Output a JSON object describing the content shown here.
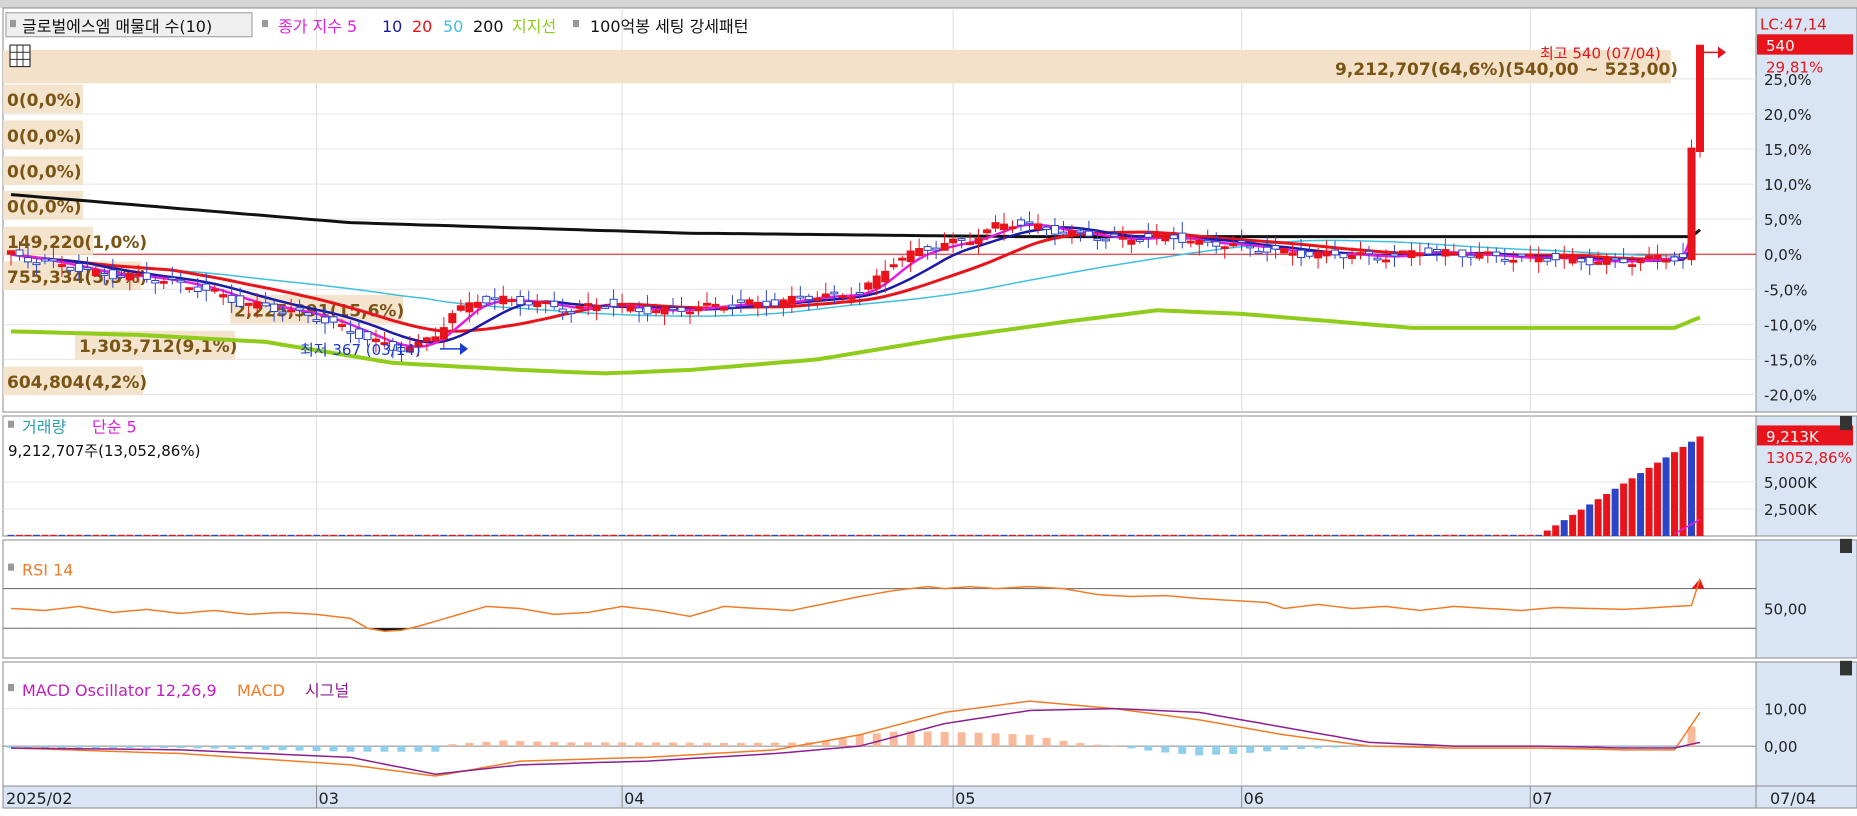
{
  "legend": {
    "main": {
      "stock_name": "글로벌에스엠 매물대 수(10)",
      "ma_label": "종가 지수 5",
      "ma_periods": [
        "10",
        "20",
        "50",
        "200"
      ],
      "support": "지지선",
      "pattern": "100억봉 세팅 강세패턴"
    },
    "volume": {
      "title": "거래량",
      "ma": "단순 5",
      "info": "9,212,707주(13,052,86%)"
    },
    "rsi": {
      "title": "RSI 14"
    },
    "macd": {
      "title": "MACD Oscillator 12,26,9",
      "macd": "MACD",
      "signal": "시그널"
    }
  },
  "annotations": {
    "high": "최고 540 (07/04)",
    "low": "최저 367 (03/14)",
    "volume_profile_top": "9,212,707(64,6%)(540,00 ~ 523,00)",
    "lc": "LC:47,14",
    "last_price": "540",
    "last_pct": "29,81%",
    "vol_last": "9,213K",
    "vol_last_pct": "13052,86%"
  },
  "volume_profile": [
    "0(0,0%)",
    "0(0,0%)",
    "0(0,0%)",
    "0(0,0%)",
    "149,220(1,0%)",
    "755,334(5,3%)",
    "2,225,391(15,6%)",
    "1,303,712(9,1%)",
    "604,804(4,2%)"
  ],
  "colors": {
    "up": "#e8131b",
    "down": "#2b44c8",
    "ma5": "#e020e0",
    "ma10": "#1a1aa8",
    "ma20": "#e8131b",
    "ma50": "#40c0e0",
    "ma200": "#111111",
    "support": "#8fcc1c",
    "rsi": "#f07c28",
    "macd": "#f07c28",
    "signal": "#8b2090",
    "osc_pos": "#f7b99a",
    "osc_neg": "#90d0ec",
    "axis_bg": "#d9e5f5",
    "profile": "#f3e1c9",
    "profile_text": "#7a5414"
  },
  "chart_data": [
    {
      "type": "line",
      "title": "글로벌에스엠",
      "y_axis_ticks": [
        "25,0%",
        "20,0%",
        "15,0%",
        "10,0%",
        "5,0%",
        "0,0%",
        "-5,0%",
        "-10,0%",
        "-15,0%",
        "-20,0%"
      ],
      "ylim_pct": [
        -22.5,
        30
      ],
      "base_pct": 0,
      "series": [
        {
          "name": "종가",
          "points": [
            [
              0,
              0
            ],
            [
              3,
              -1
            ],
            [
              6,
              -1.5
            ],
            [
              9,
              -2.5
            ],
            [
              12,
              -3
            ],
            [
              15,
              -3.2
            ],
            [
              18,
              -3.8
            ],
            [
              21,
              -4.5
            ],
            [
              24,
              -5.5
            ],
            [
              27,
              -7
            ],
            [
              30,
              -7.5
            ],
            [
              33,
              -8.2
            ],
            [
              36,
              -9
            ],
            [
              39,
              -10.5
            ],
            [
              42,
              -12
            ],
            [
              45,
              -13.5
            ],
            [
              48,
              -13
            ],
            [
              50,
              -11.5
            ],
            [
              52,
              -8.5
            ],
            [
              55,
              -6.5
            ],
            [
              58,
              -6.5
            ],
            [
              62,
              -7
            ],
            [
              66,
              -8
            ],
            [
              70,
              -7
            ],
            [
              74,
              -8
            ],
            [
              78,
              -8
            ],
            [
              82,
              -7.5
            ],
            [
              86,
              -7
            ],
            [
              90,
              -7
            ],
            [
              94,
              -6
            ],
            [
              97,
              -6
            ],
            [
              100,
              -5.5
            ],
            [
              102,
              -3.5
            ],
            [
              104,
              -1
            ],
            [
              107,
              0.5
            ],
            [
              110,
              1.5
            ],
            [
              113,
              2
            ],
            [
              116,
              4
            ],
            [
              119,
              4.5
            ],
            [
              122,
              3.5
            ],
            [
              125,
              3
            ],
            [
              128,
              2.5
            ],
            [
              131,
              2
            ],
            [
              134,
              2.5
            ],
            [
              137,
              2.5
            ],
            [
              140,
              1.5
            ],
            [
              143,
              1.5
            ],
            [
              146,
              1
            ],
            [
              149,
              0.5
            ],
            [
              152,
              0
            ],
            [
              155,
              0
            ],
            [
              158,
              0
            ],
            [
              161,
              -0.5
            ],
            [
              164,
              0
            ],
            [
              167,
              0.5
            ],
            [
              170,
              0
            ],
            [
              173,
              0
            ],
            [
              176,
              -0.5
            ],
            [
              179,
              -0.5
            ],
            [
              182,
              -0.5
            ],
            [
              185,
              -1
            ],
            [
              188,
              -1
            ],
            [
              191,
              -1
            ],
            [
              194,
              -0.5
            ],
            [
              197,
              -0.5
            ],
            [
              199,
              29.8
            ]
          ]
        },
        {
          "name": "200",
          "points": [
            [
              0,
              8.5
            ],
            [
              40,
              4.5
            ],
            [
              80,
              3
            ],
            [
              120,
              2.5
            ],
            [
              160,
              2.5
            ],
            [
              198,
              2.5
            ],
            [
              199,
              3.5
            ]
          ]
        },
        {
          "name": "지지선",
          "points": [
            [
              0,
              -11
            ],
            [
              15,
              -11.5
            ],
            [
              30,
              -12.5
            ],
            [
              45,
              -15.5
            ],
            [
              60,
              -16.5
            ],
            [
              70,
              -17
            ],
            [
              80,
              -16.5
            ],
            [
              95,
              -15
            ],
            [
              110,
              -12
            ],
            [
              125,
              -9.5
            ],
            [
              135,
              -8
            ],
            [
              145,
              -8.5
            ],
            [
              155,
              -9.5
            ],
            [
              165,
              -10.5
            ],
            [
              175,
              -10.5
            ],
            [
              190,
              -10.5
            ],
            [
              196,
              -10.5
            ],
            [
              199,
              -9
            ]
          ]
        }
      ]
    },
    {
      "type": "bar",
      "title": "거래량",
      "y_axis_ticks": [
        "5,000K",
        "2,500K"
      ],
      "ylim": [
        0,
        9800
      ],
      "values_k": [
        [
          0,
          15
        ],
        [
          30,
          15
        ],
        [
          60,
          15
        ],
        [
          90,
          15
        ],
        [
          120,
          15
        ],
        [
          150,
          15
        ],
        [
          160,
          40
        ],
        [
          165,
          30
        ],
        [
          170,
          30
        ],
        [
          175,
          25
        ],
        [
          180,
          20
        ],
        [
          199,
          9213
        ]
      ]
    },
    {
      "type": "line",
      "title": "RSI 14",
      "y_axis_ticks": [
        "50,00"
      ],
      "ylim": [
        0,
        100
      ],
      "guides": [
        70,
        30
      ],
      "points": [
        [
          0,
          50
        ],
        [
          4,
          48
        ],
        [
          8,
          52
        ],
        [
          12,
          46
        ],
        [
          16,
          49
        ],
        [
          20,
          45
        ],
        [
          24,
          48
        ],
        [
          28,
          44
        ],
        [
          32,
          46
        ],
        [
          36,
          44
        ],
        [
          40,
          40
        ],
        [
          42,
          30
        ],
        [
          44,
          27
        ],
        [
          46,
          28
        ],
        [
          48,
          32
        ],
        [
          52,
          42
        ],
        [
          56,
          52
        ],
        [
          60,
          50
        ],
        [
          64,
          44
        ],
        [
          68,
          46
        ],
        [
          72,
          52
        ],
        [
          76,
          48
        ],
        [
          80,
          42
        ],
        [
          84,
          52
        ],
        [
          88,
          50
        ],
        [
          92,
          48
        ],
        [
          96,
          55
        ],
        [
          100,
          62
        ],
        [
          104,
          68
        ],
        [
          108,
          72
        ],
        [
          110,
          70
        ],
        [
          113,
          72
        ],
        [
          116,
          70
        ],
        [
          120,
          72
        ],
        [
          124,
          70
        ],
        [
          128,
          64
        ],
        [
          132,
          62
        ],
        [
          136,
          63
        ],
        [
          140,
          60
        ],
        [
          144,
          58
        ],
        [
          148,
          56
        ],
        [
          150,
          50
        ],
        [
          154,
          54
        ],
        [
          158,
          50
        ],
        [
          162,
          52
        ],
        [
          166,
          48
        ],
        [
          170,
          52
        ],
        [
          174,
          50
        ],
        [
          178,
          48
        ],
        [
          182,
          51
        ],
        [
          186,
          50
        ],
        [
          190,
          49
        ],
        [
          194,
          51
        ],
        [
          198,
          53
        ],
        [
          199,
          80
        ]
      ]
    },
    {
      "type": "bar",
      "title": "MACD Oscillator 12,26,9",
      "y_axis_ticks": [
        "10,00",
        "0,00"
      ],
      "ylim": [
        -10,
        14
      ],
      "oscillator": [
        [
          0,
          -0.5
        ],
        [
          20,
          -0.5
        ],
        [
          30,
          -1
        ],
        [
          40,
          -1.5
        ],
        [
          50,
          -1.5
        ],
        [
          52,
          0.5
        ],
        [
          58,
          1.5
        ],
        [
          65,
          1
        ],
        [
          75,
          1
        ],
        [
          85,
          0.8
        ],
        [
          95,
          1
        ],
        [
          100,
          3
        ],
        [
          105,
          4
        ],
        [
          110,
          3.8
        ],
        [
          115,
          3.5
        ],
        [
          120,
          3
        ],
        [
          125,
          1
        ],
        [
          130,
          0
        ],
        [
          135,
          -1.5
        ],
        [
          140,
          -2.5
        ],
        [
          145,
          -2
        ],
        [
          150,
          -1
        ],
        [
          155,
          -0.5
        ],
        [
          160,
          0
        ],
        [
          170,
          0
        ],
        [
          180,
          0
        ],
        [
          190,
          -0.5
        ],
        [
          196,
          -0.5
        ],
        [
          199,
          8
        ]
      ],
      "macd": [
        [
          0,
          -0.5
        ],
        [
          20,
          -2
        ],
        [
          40,
          -5
        ],
        [
          50,
          -8
        ],
        [
          60,
          -4
        ],
        [
          75,
          -3
        ],
        [
          90,
          -1
        ],
        [
          100,
          3
        ],
        [
          110,
          9
        ],
        [
          120,
          12
        ],
        [
          130,
          10
        ],
        [
          140,
          7
        ],
        [
          150,
          3
        ],
        [
          160,
          0
        ],
        [
          170,
          -0.5
        ],
        [
          180,
          -0.5
        ],
        [
          190,
          -1
        ],
        [
          196,
          -1
        ],
        [
          199,
          9
        ]
      ],
      "signal": [
        [
          0,
          -0.5
        ],
        [
          20,
          -1
        ],
        [
          40,
          -3
        ],
        [
          50,
          -7.5
        ],
        [
          60,
          -5
        ],
        [
          75,
          -4
        ],
        [
          90,
          -2
        ],
        [
          100,
          0
        ],
        [
          110,
          6
        ],
        [
          120,
          9.5
        ],
        [
          130,
          10
        ],
        [
          140,
          9
        ],
        [
          150,
          5
        ],
        [
          160,
          1
        ],
        [
          170,
          0
        ],
        [
          180,
          0
        ],
        [
          190,
          -0.5
        ],
        [
          196,
          -0.5
        ],
        [
          199,
          1
        ]
      ]
    }
  ],
  "x_axis": {
    "labels": [
      {
        "text": "2025/02",
        "idx": 0
      },
      {
        "text": "03",
        "idx": 36
      },
      {
        "text": "04",
        "idx": 72
      },
      {
        "text": "05",
        "idx": 111
      },
      {
        "text": "06",
        "idx": 145
      },
      {
        "text": "07",
        "idx": 179
      }
    ],
    "right_label": "07/04"
  }
}
